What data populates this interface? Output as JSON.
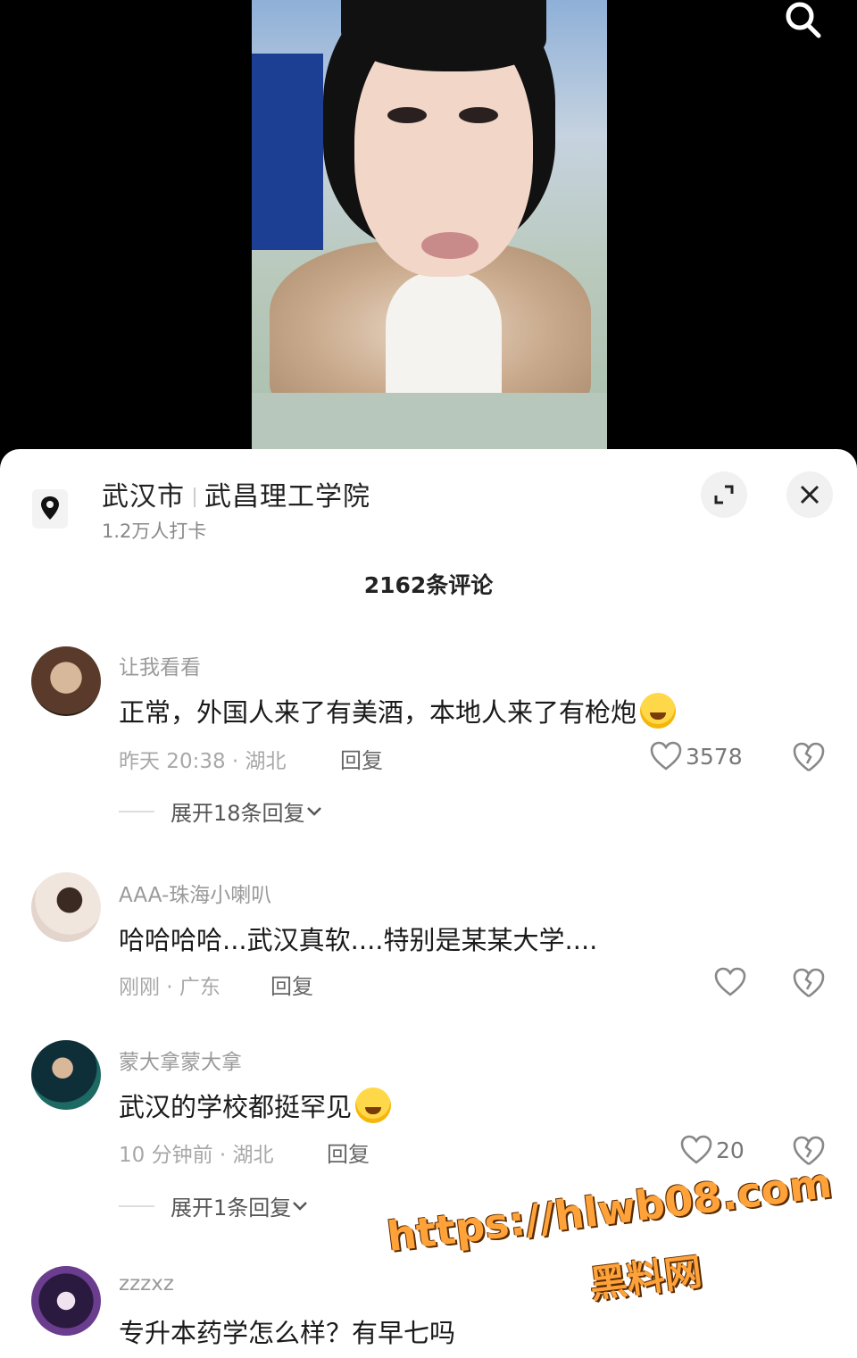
{
  "location": {
    "city": "武汉市",
    "place": "武昌理工学院",
    "checkins": "1.2万人打卡"
  },
  "icons": {
    "search": "search-icon",
    "location": "location-pin-icon",
    "expand": "expand-icon",
    "close": "close-icon",
    "like": "heart-icon",
    "dislike": "broken-heart-icon",
    "chevron": "chevron-down-icon"
  },
  "comments_header": "2162条评论",
  "comments": [
    {
      "user": "让我看看",
      "text": "正常，外国人来了有美酒，本地人来了有枪炮",
      "meta": "昨天 20:38 · 湖北",
      "reply_label": "回复",
      "likes": "3578",
      "expand": "展开18条回复"
    },
    {
      "user": "AAA-珠海小喇叭",
      "text": "哈哈哈哈...武汉真软....特别是某某大学....",
      "meta": "刚刚 · 广东",
      "reply_label": "回复",
      "likes": ""
    },
    {
      "user": "蒙大拿蒙大拿",
      "text": "武汉的学校都挺罕见",
      "meta": "10 分钟前 · 湖北",
      "reply_label": "回复",
      "likes": "20",
      "expand": "展开1条回复"
    },
    {
      "user": "zzzxz",
      "text": "专升本药学怎么样？有早七吗"
    }
  ],
  "watermark": {
    "url": "https://hlwb08.com",
    "name": "黑料网"
  }
}
